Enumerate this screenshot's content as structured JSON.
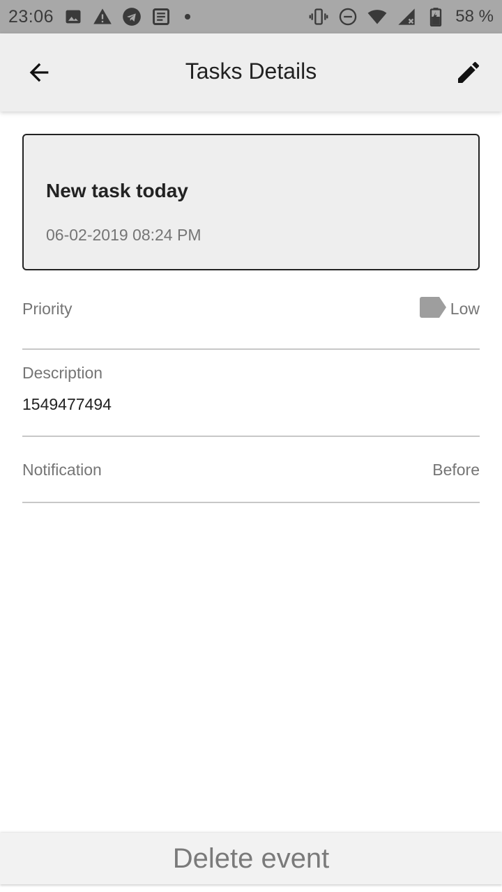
{
  "status_bar": {
    "time": "23:06",
    "left_icons": [
      "image-icon",
      "warning-icon",
      "telegram-icon",
      "news-icon",
      "dot-icon"
    ],
    "right_icons": [
      "vibrate-icon",
      "do-not-disturb-icon",
      "wifi-icon",
      "signal-icon",
      "battery-icon"
    ],
    "battery": "58 %"
  },
  "app_bar": {
    "title": "Tasks Details",
    "back_icon": "arrow-back-icon",
    "edit_icon": "pencil-icon"
  },
  "task": {
    "title": "New task today",
    "datetime": "06-02-2019 08:24 PM"
  },
  "details": {
    "priority_label": "Priority",
    "priority_value": "Low",
    "priority_icon": "label-tag-icon",
    "description_label": "Description",
    "description_value": "1549477494",
    "notification_label": "Notification",
    "notification_value": "Before"
  },
  "actions": {
    "delete_label": "Delete event"
  },
  "colors": {
    "status_bar": "#a8a8a8",
    "app_bar": "#eeeeee",
    "card": "#eeeeee",
    "muted_text": "#757575",
    "tag": "#9e9e9e"
  }
}
